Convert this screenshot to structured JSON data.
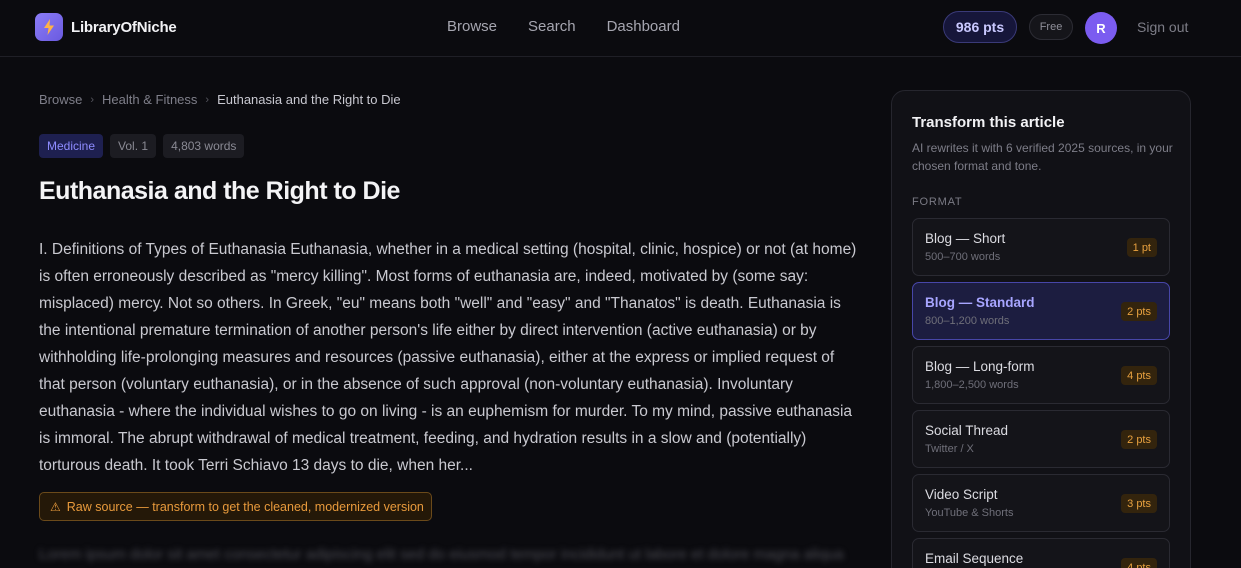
{
  "brand": {
    "name": "LibraryOfNiche",
    "logo_icon": "lightning-bolt-icon"
  },
  "nav": {
    "items": [
      "Browse",
      "Search",
      "Dashboard"
    ]
  },
  "account": {
    "points": "986 pts",
    "plan": "Free",
    "avatar_initial": "R",
    "sign_out": "Sign out"
  },
  "breadcrumb": {
    "items": [
      "Browse",
      "Health & Fitness",
      "Euthanasia and the Right to Die"
    ]
  },
  "tags": {
    "category": "Medicine",
    "volume": "Vol. 1",
    "word_count": "4,803 words"
  },
  "article": {
    "title": "Euthanasia and the Right to Die",
    "body": "I. Definitions of Types of Euthanasia Euthanasia, whether in a medical setting (hospital, clinic, hospice) or not (at home) is often erroneously described as \"mercy killing\". Most forms of euthanasia are, indeed, motivated by (some say: misplaced) mercy. Not so others. In Greek, \"eu\" means both \"well\" and \"easy\" and \"Thanatos\" is death. Euthanasia is the intentional premature termination of another person's life either by direct intervention (active euthanasia) or by withholding life-prolonging measures and resources (passive euthanasia), either at the express or implied request of that person (voluntary euthanasia), or in the absence of such approval (non-voluntary euthanasia). Involuntary euthanasia - where the individual wishes to go on living - is an euphemism for murder. To my mind, passive euthanasia is immoral. The abrupt withdrawal of medical treatment, feeding, and hydration results in a slow and (potentially) torturous death. It took Terri Schiavo 13 days to die, when her...",
    "warning": "Raw source — transform to get the cleaned, modernized version",
    "blurred_preview": "Lorem ipsum dolor sit amet consectetur adipiscing elit sed do eiusmod tempor incididunt ut labore et dolore magna aliqua"
  },
  "panel": {
    "title": "Transform this article",
    "description": "AI rewrites it with 6 verified 2025 sources, in your chosen format and tone.",
    "format_label": "FORMAT",
    "options": [
      {
        "name": "Blog — Short",
        "sub": "500–700 words",
        "cost": "1 pt"
      },
      {
        "name": "Blog — Standard",
        "sub": "800–1,200 words",
        "cost": "2 pts"
      },
      {
        "name": "Blog — Long-form",
        "sub": "1,800–2,500 words",
        "cost": "4 pts"
      },
      {
        "name": "Social Thread",
        "sub": "Twitter / X",
        "cost": "2 pts"
      },
      {
        "name": "Video Script",
        "sub": "YouTube & Shorts",
        "cost": "3 pts"
      },
      {
        "name": "Email Sequence",
        "sub": "",
        "cost": "4 pts"
      }
    ]
  }
}
